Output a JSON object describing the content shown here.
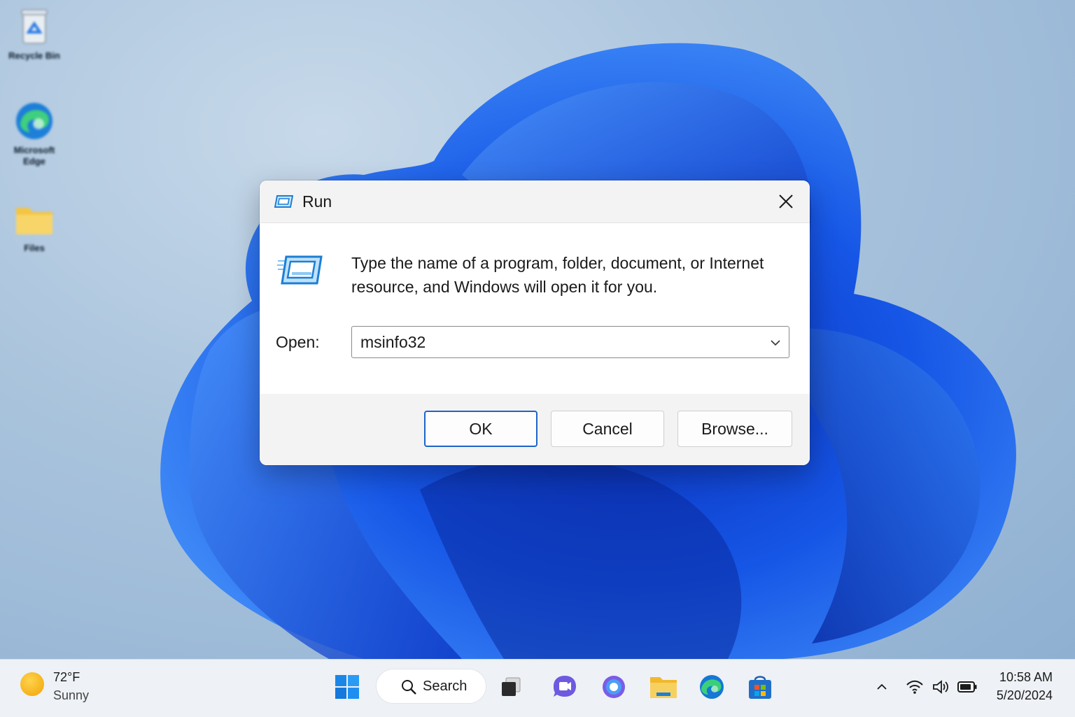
{
  "desktop": {
    "icons": [
      {
        "label": "Recycle Bin",
        "icon": "recycle-bin-icon"
      },
      {
        "label": "Microsoft Edge",
        "icon": "edge-icon"
      },
      {
        "label": "Files",
        "icon": "folder-icon"
      }
    ]
  },
  "dialog": {
    "title": "Run",
    "title_icon": "run-icon",
    "description": "Type the name of a program, folder, document, or Internet resource, and Windows will open it for you.",
    "open_label": "Open:",
    "open_value": "msinfo32",
    "buttons": {
      "ok": "OK",
      "cancel": "Cancel",
      "browse": "Browse..."
    }
  },
  "taskbar": {
    "weather": {
      "temp": "72°F",
      "condition": "Sunny"
    },
    "search_label": "Search",
    "apps": [
      "start-icon",
      "task-view-icon",
      "chat-icon",
      "copilot-icon",
      "file-explorer-icon",
      "edge-icon",
      "store-icon"
    ],
    "tray": [
      "chevron-up-icon",
      "wifi-icon",
      "volume-icon",
      "battery-icon"
    ],
    "clock": {
      "time": "10:58 AM",
      "date": "5/20/2024"
    }
  },
  "colors": {
    "accent": "#1e64c8",
    "wallpaper_blue": "#1c5fe0",
    "dialog_bg": "#ffffff",
    "taskbar_bg": "#eef1f5"
  }
}
